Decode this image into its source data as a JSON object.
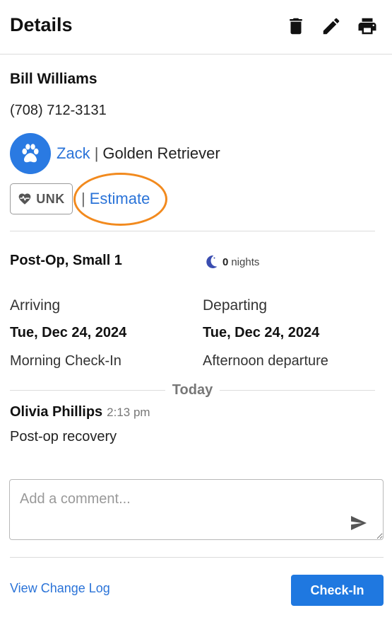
{
  "header": {
    "title": "Details",
    "icons": [
      "delete-icon",
      "edit-icon",
      "print-icon"
    ]
  },
  "owner": {
    "name": "Bill Williams",
    "phone": "(708) 712-3131"
  },
  "pet": {
    "name": "Zack",
    "separator": "|",
    "breed": "Golden Retriever",
    "avatar_color": "#2a7ae2"
  },
  "status": {
    "badge": "UNK",
    "separator": "|",
    "estimate_link": "Estimate",
    "highlight_color": "#f28a1e"
  },
  "stay": {
    "room": "Post-Op, Small 1",
    "nights_count": "0",
    "nights_label": "nights",
    "arriving_label": "Arriving",
    "arriving_date": "Tue, Dec 24, 2024",
    "arriving_note": "Morning Check-In",
    "departing_label": "Departing",
    "departing_date": "Tue, Dec 24, 2024",
    "departing_note": "Afternoon departure"
  },
  "timeline": {
    "divider_label": "Today",
    "comments": [
      {
        "author": "Olivia Phillips",
        "time": "2:13 pm",
        "text": "Post-op recovery"
      }
    ]
  },
  "comment_input": {
    "value": "",
    "placeholder": "Add a comment..."
  },
  "footer": {
    "change_log_link": "View Change Log",
    "checkin_label": "Check-In",
    "primary_color": "#1f78e0"
  }
}
